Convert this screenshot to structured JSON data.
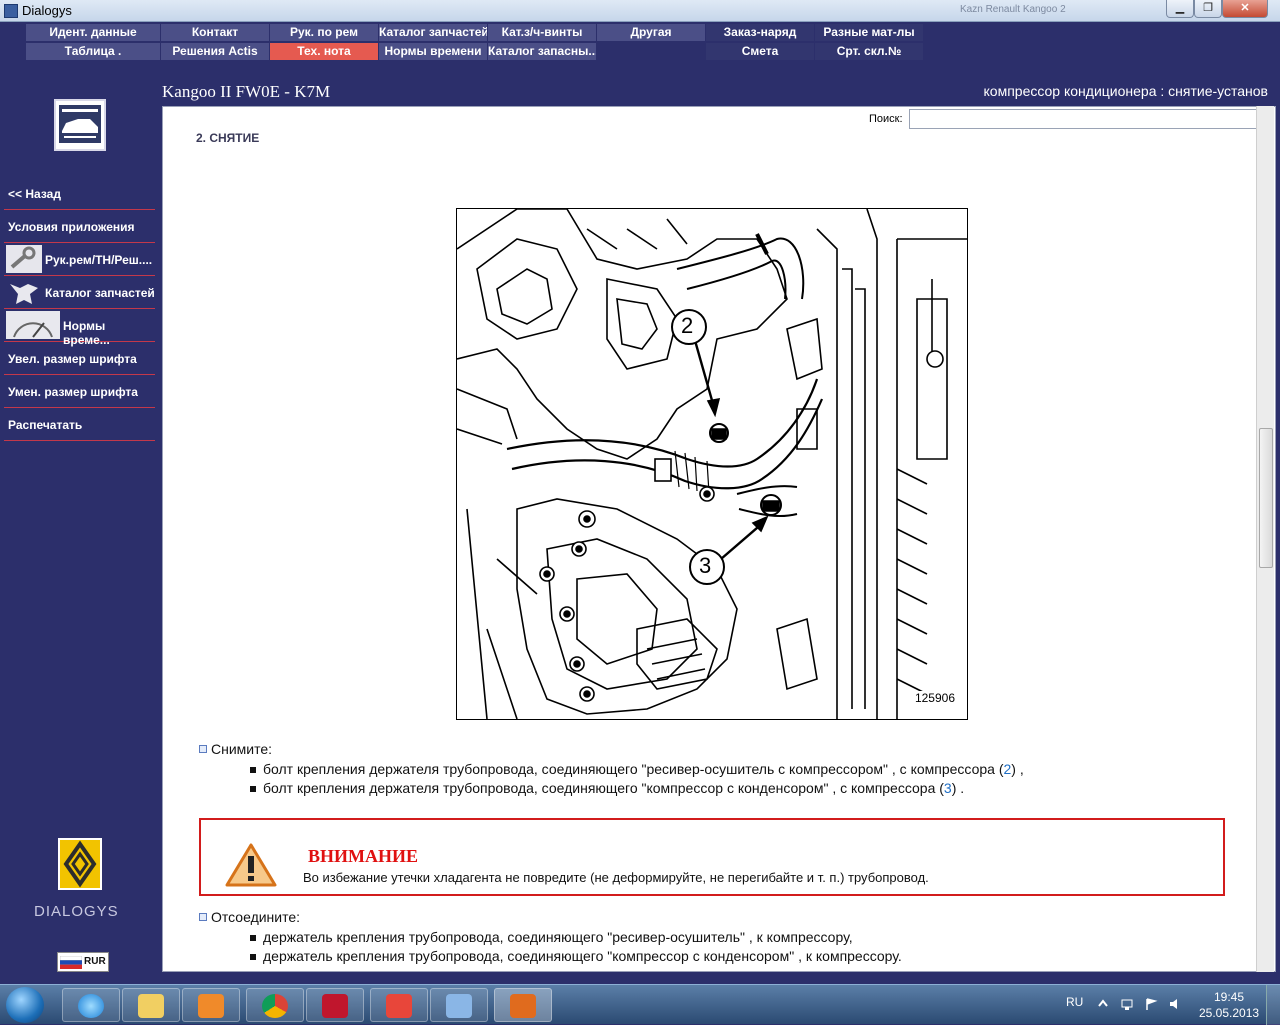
{
  "window": {
    "title": "Dialogys",
    "background_title": "Kazn Renault Kangoo 2"
  },
  "menu": {
    "row1": [
      "Идент. данные",
      "Контакт",
      "Рук. по рем",
      "Каталог запчастей",
      "Кат.з/ч-винты",
      "Другая",
      "Заказ-наряд",
      "Разные мат-лы"
    ],
    "row2": [
      "Таблица .",
      "Решения Actis",
      "Тех. нота",
      "Нормы времени",
      "Каталог запасны...",
      "",
      "Смета",
      "Срт. скл.№"
    ]
  },
  "header": {
    "vehicle": "Kangoo II FW0E - K7M",
    "operation": "компрессор кондиционера : снятие-установ"
  },
  "sidebar": {
    "items": [
      {
        "label": "<< Назад"
      },
      {
        "label": "Условия приложения"
      },
      {
        "label": "Рук.рем/ТН/Реш...."
      },
      {
        "label": "Каталог запчастей"
      },
      {
        "label": "Нормы време..."
      },
      {
        "label": "Увел. размер шрифта"
      },
      {
        "label": "Умен. размер шрифта"
      },
      {
        "label": "Распечатать"
      }
    ],
    "brand_text": "DIALOGYS",
    "currency": "RUR"
  },
  "search": {
    "label": "Поиск:",
    "value": ""
  },
  "document": {
    "section_title": "2. СНЯТИЕ",
    "figure": {
      "code": "125906",
      "callout_2": "2",
      "callout_3": "3"
    },
    "remove_heading": "Снимите:",
    "remove_items": [
      {
        "text": "болт крепления держателя трубопровода, соединяющего \"ресивер-осушитель с компрессором\" , с компрессора (",
        "ref": "2",
        "tail": ") ,"
      },
      {
        "text": "болт крепления держателя трубопровода, соединяющего \"компрессор с конденсором\" , с компрессора (",
        "ref": "3",
        "tail": ") ."
      }
    ],
    "warning": {
      "title": "ВНИМАНИЕ",
      "text": "Во избежание утечки хладагента не повредите (не деформируйте, не перегибайте и т. п.) трубопровод."
    },
    "disconnect_heading": "Отсоедините:",
    "disconnect_items": [
      "держатель крепления трубопровода, соединяющего \"ресивер-осушитель\" , к компрессору,",
      "держатель крепления трубопровода, соединяющего \"компрессор с конденсором\" , к компрессору."
    ]
  },
  "taskbar": {
    "apps": [
      "internet-explorer",
      "file-explorer",
      "media-player",
      "chrome",
      "kaspersky",
      "yandex-browser",
      "sound-app",
      "java-app"
    ],
    "language": "RU",
    "time": "19:45",
    "date": "25.05.2013"
  }
}
